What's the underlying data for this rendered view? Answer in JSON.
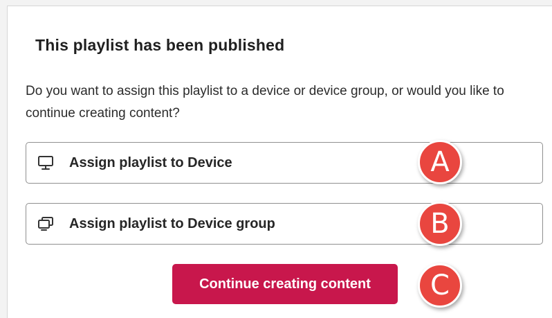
{
  "dialog": {
    "title": "This playlist has been published",
    "message": "Do you want to assign this playlist to a device or device group, or would you like to continue creating content?"
  },
  "options": [
    {
      "label": "Assign playlist to Device",
      "icon": "monitor-icon"
    },
    {
      "label": "Assign playlist to Device group",
      "icon": "device-group-icon"
    }
  ],
  "primary_button": {
    "label": "Continue creating content"
  },
  "markers": [
    "A",
    "B",
    "C"
  ],
  "colors": {
    "primary": "#c8174c",
    "marker": "#e9463f",
    "border": "#8f8f8f"
  }
}
